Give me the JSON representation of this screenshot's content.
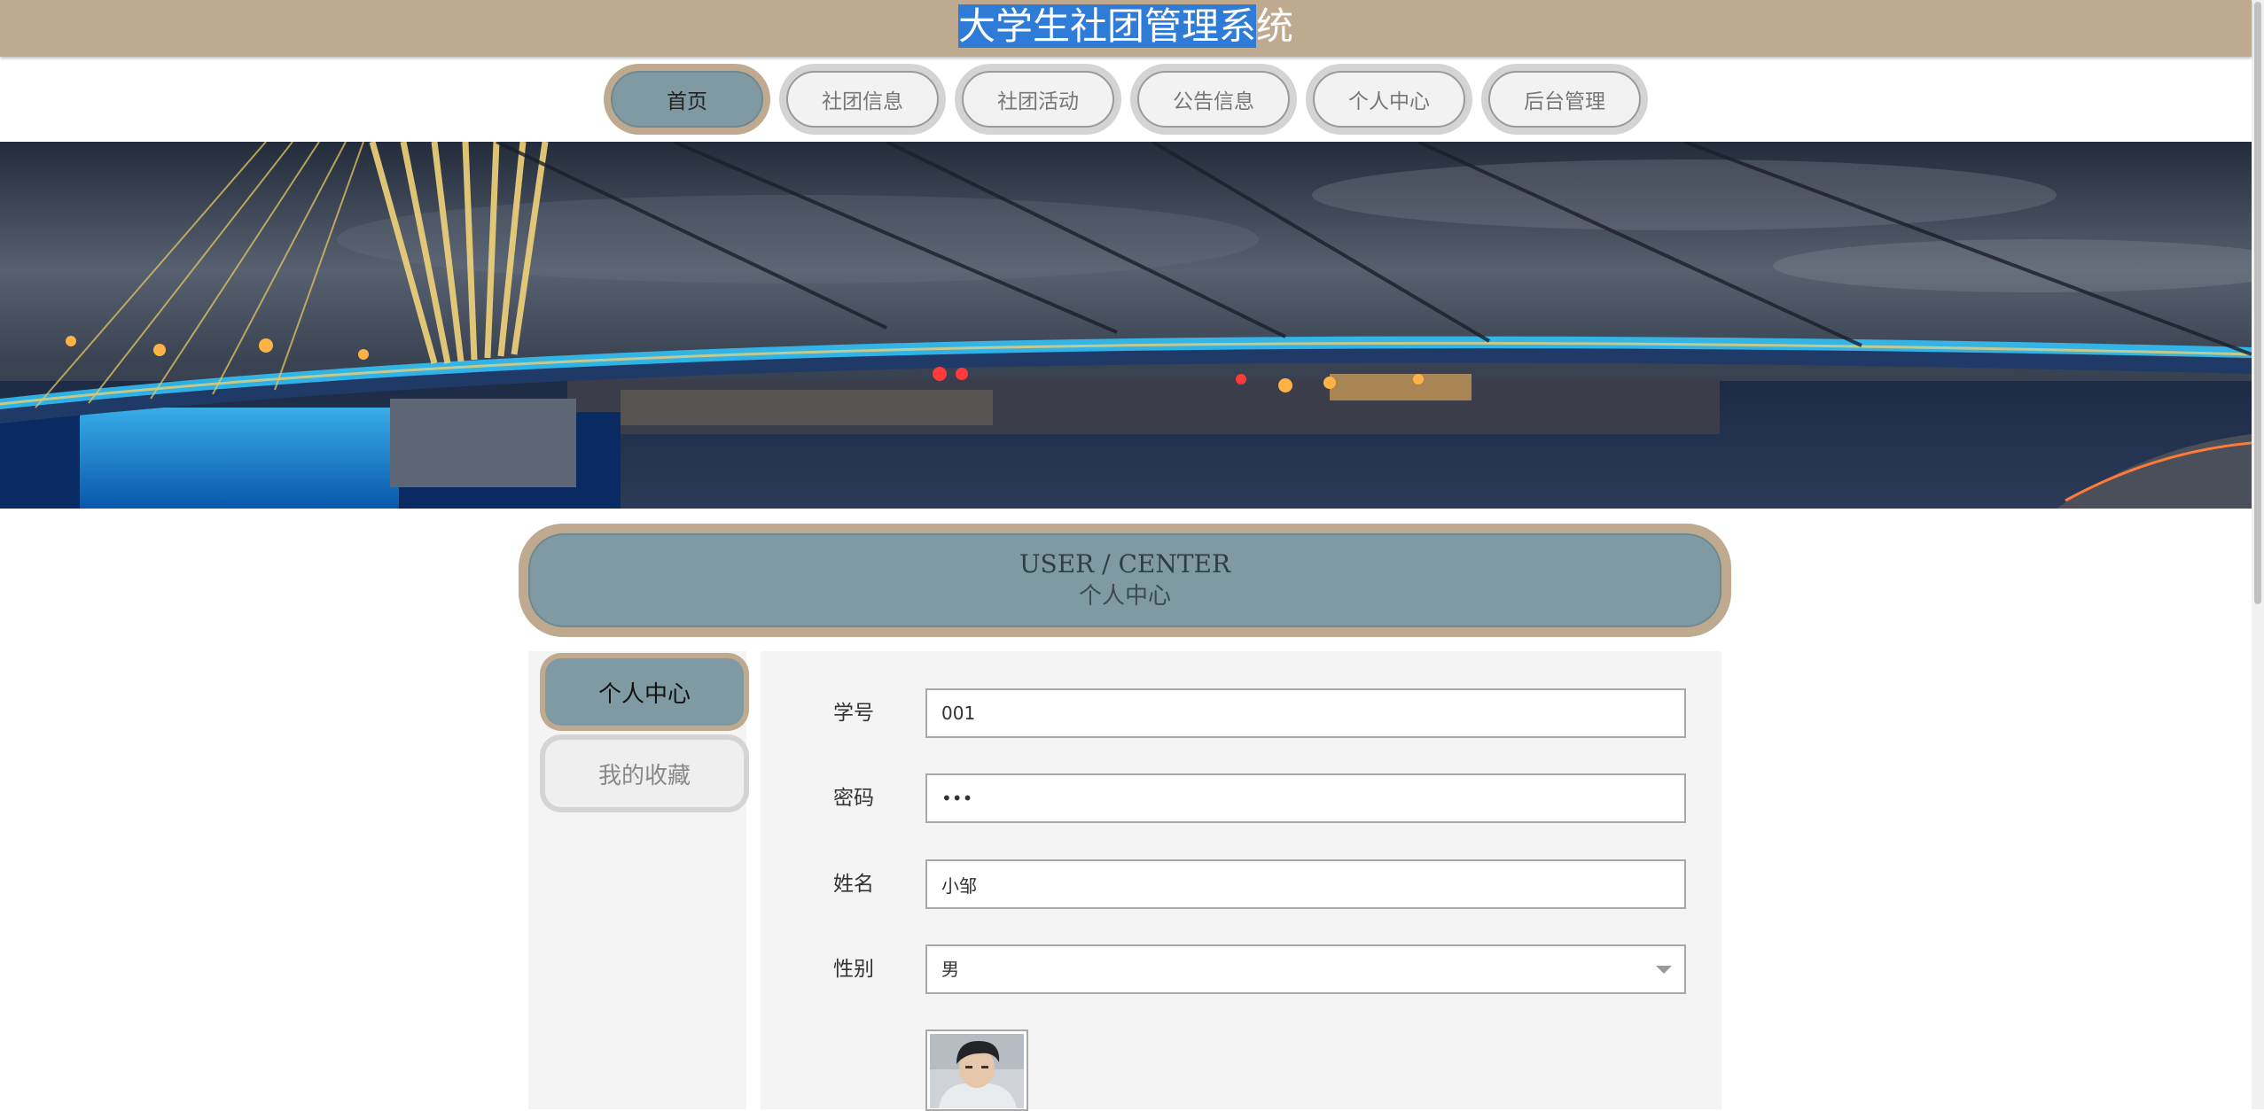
{
  "header": {
    "title_selected": "大学生社团管理系",
    "title_rest": "统"
  },
  "nav": {
    "items": [
      {
        "label": "首页",
        "active": true
      },
      {
        "label": "社团信息"
      },
      {
        "label": "社团活动"
      },
      {
        "label": "公告信息"
      },
      {
        "label": "个人中心"
      },
      {
        "label": "后台管理"
      }
    ]
  },
  "section": {
    "title_en": "USER / CENTER",
    "title_cn": "个人中心"
  },
  "sidebar": {
    "items": [
      {
        "label": "个人中心",
        "active": true
      },
      {
        "label": "我的收藏"
      }
    ]
  },
  "form": {
    "student_id": {
      "label": "学号",
      "value": "001"
    },
    "password": {
      "label": "密码",
      "value": "•••"
    },
    "name": {
      "label": "姓名",
      "value": "小邹"
    },
    "gender": {
      "label": "性别",
      "value": "男"
    }
  },
  "colors": {
    "tan": "#bfaa8f",
    "slate": "#7f9aa3",
    "panel": "#f4f4f4",
    "selection": "#2f7bd8"
  },
  "icons": {
    "select_arrow": "chevron-down-icon"
  }
}
